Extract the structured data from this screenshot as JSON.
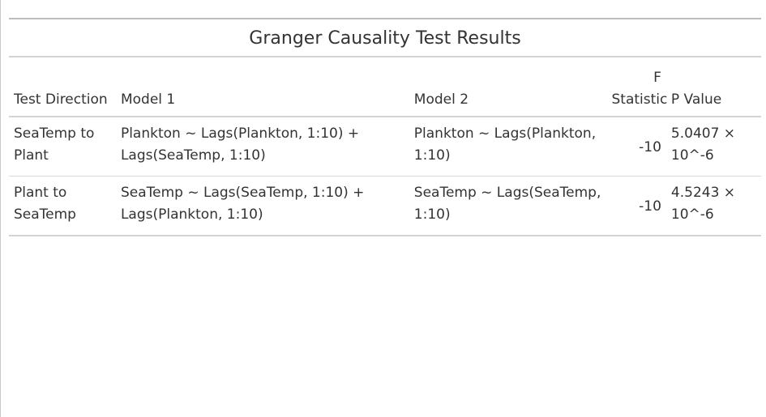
{
  "table": {
    "title": "Granger Causality Test Results",
    "headers": {
      "direction": "Test Direction",
      "model1": "Model 1",
      "model2": "Model 2",
      "f_stat_line1": "F",
      "f_stat_line2": "Statistic",
      "p_value": "P Value"
    },
    "rows": [
      {
        "direction": "SeaTemp to Plant",
        "model1": "Plankton ~ Lags(Plankton, 1:10) + Lags(SeaTemp, 1:10)",
        "model2": "Plankton ~ Lags(Plankton, 1:10)",
        "f_stat": "-10",
        "p_value": "5.0407 × 10^-6"
      },
      {
        "direction": "Plant to SeaTemp",
        "model1": "SeaTemp ~ Lags(SeaTemp, 1:10) + Lags(Plankton, 1:10)",
        "model2": "SeaTemp ~ Lags(SeaTemp, 1:10)",
        "f_stat": "-10",
        "p_value": "4.5243 × 10^-6"
      }
    ]
  }
}
